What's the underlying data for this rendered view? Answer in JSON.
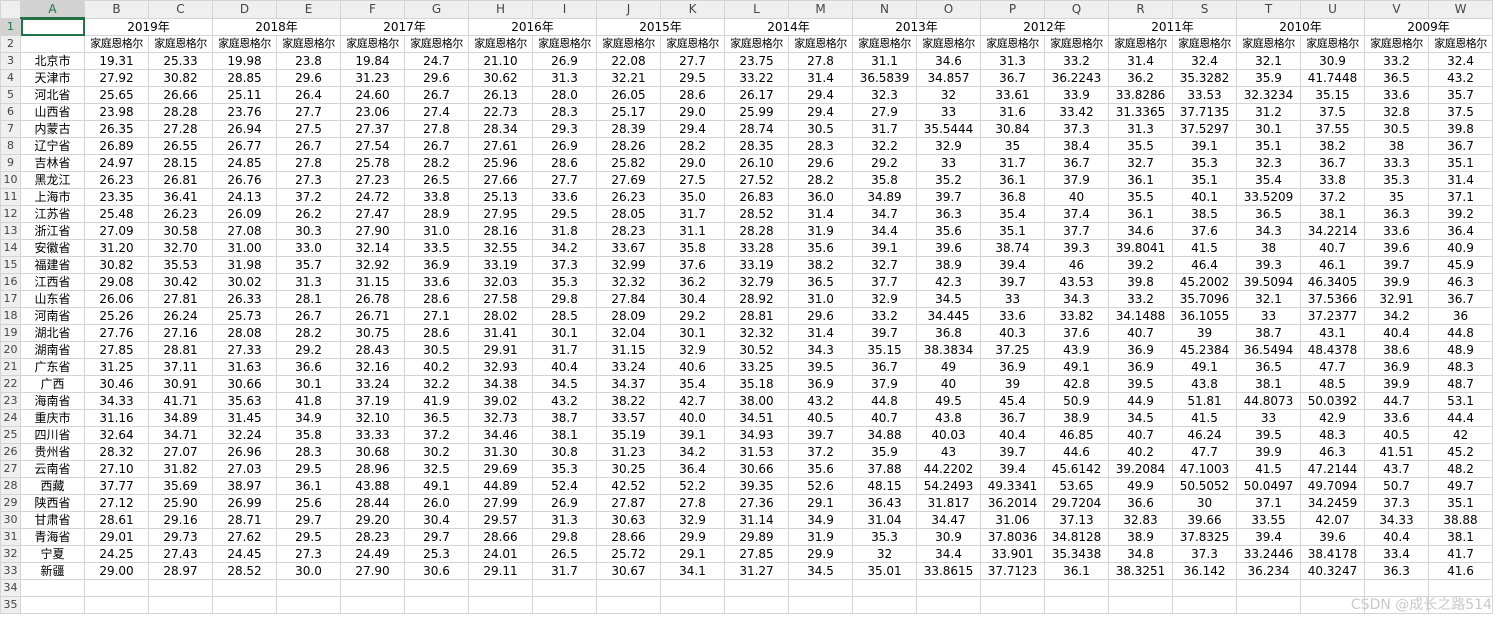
{
  "columns": [
    "A",
    "B",
    "C",
    "D",
    "E",
    "F",
    "G",
    "H",
    "I",
    "J",
    "K",
    "L",
    "M",
    "N",
    "O",
    "P",
    "Q",
    "R",
    "S",
    "T",
    "U",
    "V",
    "W"
  ],
  "years": [
    "2019年",
    "2018年",
    "2017年",
    "2016年",
    "2015年",
    "2014年",
    "2013年",
    "2012年",
    "2011年",
    "2010年",
    "2009年"
  ],
  "subheader": "家庭恩格尔",
  "rows": [
    {
      "label": "北京市",
      "values": [
        "19.31",
        "25.33",
        "19.98",
        "23.8",
        "19.84",
        "24.7",
        "21.10",
        "26.9",
        "22.08",
        "27.7",
        "23.75",
        "27.8",
        "31.1",
        "34.6",
        "31.3",
        "33.2",
        "31.4",
        "32.4",
        "32.1",
        "30.9",
        "33.2",
        "32.4"
      ]
    },
    {
      "label": "天津市",
      "values": [
        "27.92",
        "30.82",
        "28.85",
        "29.6",
        "31.23",
        "29.6",
        "30.62",
        "31.3",
        "32.21",
        "29.5",
        "33.22",
        "31.4",
        "36.5839",
        "34.857",
        "36.7",
        "36.2243",
        "36.2",
        "35.3282",
        "35.9",
        "41.7448",
        "36.5",
        "43.2"
      ]
    },
    {
      "label": "河北省",
      "values": [
        "25.65",
        "26.66",
        "25.11",
        "26.4",
        "24.60",
        "26.7",
        "26.13",
        "28.0",
        "26.05",
        "28.6",
        "26.17",
        "29.4",
        "32.3",
        "32",
        "33.61",
        "33.9",
        "33.8286",
        "33.53",
        "32.3234",
        "35.15",
        "33.6",
        "35.7"
      ]
    },
    {
      "label": "山西省",
      "values": [
        "23.98",
        "28.28",
        "23.76",
        "27.7",
        "23.06",
        "27.4",
        "22.73",
        "28.3",
        "25.17",
        "29.0",
        "25.99",
        "29.4",
        "27.9",
        "33",
        "31.6",
        "33.42",
        "31.3365",
        "37.7135",
        "31.2",
        "37.5",
        "32.8",
        "37.5"
      ]
    },
    {
      "label": "内蒙古",
      "values": [
        "26.35",
        "27.28",
        "26.94",
        "27.5",
        "27.37",
        "27.8",
        "28.34",
        "29.3",
        "28.39",
        "29.4",
        "28.74",
        "30.5",
        "31.7",
        "35.5444",
        "30.84",
        "37.3",
        "31.3",
        "37.5297",
        "30.1",
        "37.55",
        "30.5",
        "39.8"
      ]
    },
    {
      "label": "辽宁省",
      "values": [
        "26.89",
        "26.55",
        "26.77",
        "26.7",
        "27.54",
        "26.7",
        "27.61",
        "26.9",
        "28.26",
        "28.2",
        "28.35",
        "28.3",
        "32.2",
        "32.9",
        "35",
        "38.4",
        "35.5",
        "39.1",
        "35.1",
        "38.2",
        "38",
        "36.7"
      ]
    },
    {
      "label": "吉林省",
      "values": [
        "24.97",
        "28.15",
        "24.85",
        "27.8",
        "25.78",
        "28.2",
        "25.96",
        "28.6",
        "25.82",
        "29.0",
        "26.10",
        "29.6",
        "29.2",
        "33",
        "31.7",
        "36.7",
        "32.7",
        "35.3",
        "32.3",
        "36.7",
        "33.3",
        "35.1"
      ]
    },
    {
      "label": "黑龙江",
      "values": [
        "26.23",
        "26.81",
        "26.76",
        "27.3",
        "27.23",
        "26.5",
        "27.66",
        "27.7",
        "27.69",
        "27.5",
        "27.52",
        "28.2",
        "35.8",
        "35.2",
        "36.1",
        "37.9",
        "36.1",
        "35.1",
        "35.4",
        "33.8",
        "35.3",
        "31.4"
      ]
    },
    {
      "label": "上海市",
      "values": [
        "23.35",
        "36.41",
        "24.13",
        "37.2",
        "24.72",
        "33.8",
        "25.13",
        "33.6",
        "26.23",
        "35.0",
        "26.83",
        "36.0",
        "34.89",
        "39.7",
        "36.8",
        "40",
        "35.5",
        "40.1",
        "33.5209",
        "37.2",
        "35",
        "37.1"
      ]
    },
    {
      "label": "江苏省",
      "values": [
        "25.48",
        "26.23",
        "26.09",
        "26.2",
        "27.47",
        "28.9",
        "27.95",
        "29.5",
        "28.05",
        "31.7",
        "28.52",
        "31.4",
        "34.7",
        "36.3",
        "35.4",
        "37.4",
        "36.1",
        "38.5",
        "36.5",
        "38.1",
        "36.3",
        "39.2"
      ]
    },
    {
      "label": "浙江省",
      "values": [
        "27.09",
        "30.58",
        "27.08",
        "30.3",
        "27.90",
        "31.0",
        "28.16",
        "31.8",
        "28.23",
        "31.1",
        "28.28",
        "31.9",
        "34.4",
        "35.6",
        "35.1",
        "37.7",
        "34.6",
        "37.6",
        "34.3",
        "34.2214",
        "33.6",
        "36.4"
      ]
    },
    {
      "label": "安徽省",
      "values": [
        "31.20",
        "32.70",
        "31.00",
        "33.0",
        "32.14",
        "33.5",
        "32.55",
        "34.2",
        "33.67",
        "35.8",
        "33.28",
        "35.6",
        "39.1",
        "39.6",
        "38.74",
        "39.3",
        "39.8041",
        "41.5",
        "38",
        "40.7",
        "39.6",
        "40.9"
      ]
    },
    {
      "label": "福建省",
      "values": [
        "30.82",
        "35.53",
        "31.98",
        "35.7",
        "32.92",
        "36.9",
        "33.19",
        "37.3",
        "32.99",
        "37.6",
        "33.19",
        "38.2",
        "32.7",
        "38.9",
        "39.4",
        "46",
        "39.2",
        "46.4",
        "39.3",
        "46.1",
        "39.7",
        "45.9"
      ]
    },
    {
      "label": "江西省",
      "values": [
        "29.08",
        "30.42",
        "30.02",
        "31.3",
        "31.15",
        "33.6",
        "32.03",
        "35.3",
        "32.32",
        "36.2",
        "32.79",
        "36.5",
        "37.7",
        "42.3",
        "39.7",
        "43.53",
        "39.8",
        "45.2002",
        "39.5094",
        "46.3405",
        "39.9",
        "46.3"
      ]
    },
    {
      "label": "山东省",
      "values": [
        "26.06",
        "27.81",
        "26.33",
        "28.1",
        "26.78",
        "28.6",
        "27.58",
        "29.8",
        "27.84",
        "30.4",
        "28.92",
        "31.0",
        "32.9",
        "34.5",
        "33",
        "34.3",
        "33.2",
        "35.7096",
        "32.1",
        "37.5366",
        "32.91",
        "36.7"
      ]
    },
    {
      "label": "河南省",
      "values": [
        "25.26",
        "26.24",
        "25.73",
        "26.7",
        "26.71",
        "27.1",
        "28.02",
        "28.5",
        "28.09",
        "29.2",
        "28.81",
        "29.6",
        "33.2",
        "34.445",
        "33.6",
        "33.82",
        "34.1488",
        "36.1055",
        "33",
        "37.2377",
        "34.2",
        "36"
      ]
    },
    {
      "label": "湖北省",
      "values": [
        "27.76",
        "27.16",
        "28.08",
        "28.2",
        "30.75",
        "28.6",
        "31.41",
        "30.1",
        "32.04",
        "30.1",
        "32.32",
        "31.4",
        "39.7",
        "36.8",
        "40.3",
        "37.6",
        "40.7",
        "39",
        "38.7",
        "43.1",
        "40.4",
        "44.8"
      ]
    },
    {
      "label": "湖南省",
      "values": [
        "27.85",
        "28.81",
        "27.33",
        "29.2",
        "28.43",
        "30.5",
        "29.91",
        "31.7",
        "31.15",
        "32.9",
        "30.52",
        "34.3",
        "35.15",
        "38.3834",
        "37.25",
        "43.9",
        "36.9",
        "45.2384",
        "36.5494",
        "48.4378",
        "38.6",
        "48.9"
      ]
    },
    {
      "label": "广东省",
      "values": [
        "31.25",
        "37.11",
        "31.63",
        "36.6",
        "32.16",
        "40.2",
        "32.93",
        "40.4",
        "33.24",
        "40.6",
        "33.25",
        "39.5",
        "36.7",
        "49",
        "36.9",
        "49.1",
        "36.9",
        "49.1",
        "36.5",
        "47.7",
        "36.9",
        "48.3"
      ]
    },
    {
      "label": "广西",
      "values": [
        "30.46",
        "30.91",
        "30.66",
        "30.1",
        "33.24",
        "32.2",
        "34.38",
        "34.5",
        "34.37",
        "35.4",
        "35.18",
        "36.9",
        "37.9",
        "40",
        "39",
        "42.8",
        "39.5",
        "43.8",
        "38.1",
        "48.5",
        "39.9",
        "48.7"
      ]
    },
    {
      "label": "海南省",
      "values": [
        "34.33",
        "41.71",
        "35.63",
        "41.8",
        "37.19",
        "41.9",
        "39.02",
        "43.2",
        "38.22",
        "42.7",
        "38.00",
        "43.2",
        "44.8",
        "49.5",
        "45.4",
        "50.9",
        "44.9",
        "51.81",
        "44.8073",
        "50.0392",
        "44.7",
        "53.1"
      ]
    },
    {
      "label": "重庆市",
      "values": [
        "31.16",
        "34.89",
        "31.45",
        "34.9",
        "32.10",
        "36.5",
        "32.73",
        "38.7",
        "33.57",
        "40.0",
        "34.51",
        "40.5",
        "40.7",
        "43.8",
        "36.7",
        "38.9",
        "34.5",
        "41.5",
        "33",
        "42.9",
        "33.6",
        "44.4"
      ]
    },
    {
      "label": "四川省",
      "values": [
        "32.64",
        "34.71",
        "32.24",
        "35.8",
        "33.33",
        "37.2",
        "34.46",
        "38.1",
        "35.19",
        "39.1",
        "34.93",
        "39.7",
        "34.88",
        "40.03",
        "40.4",
        "46.85",
        "40.7",
        "46.24",
        "39.5",
        "48.3",
        "40.5",
        "42"
      ]
    },
    {
      "label": "贵州省",
      "values": [
        "28.32",
        "27.07",
        "26.96",
        "28.3",
        "30.68",
        "30.2",
        "31.30",
        "30.8",
        "31.23",
        "34.2",
        "31.53",
        "37.2",
        "35.9",
        "43",
        "39.7",
        "44.6",
        "40.2",
        "47.7",
        "39.9",
        "46.3",
        "41.51",
        "45.2"
      ]
    },
    {
      "label": "云南省",
      "values": [
        "27.10",
        "31.82",
        "27.03",
        "29.5",
        "28.96",
        "32.5",
        "29.69",
        "35.3",
        "30.25",
        "36.4",
        "30.66",
        "35.6",
        "37.88",
        "44.2202",
        "39.4",
        "45.6142",
        "39.2084",
        "47.1003",
        "41.5",
        "47.2144",
        "43.7",
        "48.2"
      ]
    },
    {
      "label": "西藏",
      "values": [
        "37.77",
        "35.69",
        "38.97",
        "36.1",
        "43.88",
        "49.1",
        "44.89",
        "52.4",
        "42.52",
        "52.2",
        "39.35",
        "52.6",
        "48.15",
        "54.2493",
        "49.3341",
        "53.65",
        "49.9",
        "50.5052",
        "50.0497",
        "49.7094",
        "50.7",
        "49.7"
      ]
    },
    {
      "label": "陕西省",
      "values": [
        "27.12",
        "25.90",
        "26.99",
        "25.6",
        "28.44",
        "26.0",
        "27.99",
        "26.9",
        "27.87",
        "27.8",
        "27.36",
        "29.1",
        "36.43",
        "31.817",
        "36.2014",
        "29.7204",
        "36.6",
        "30",
        "37.1",
        "34.2459",
        "37.3",
        "35.1"
      ]
    },
    {
      "label": "甘肃省",
      "values": [
        "28.61",
        "29.16",
        "28.71",
        "29.7",
        "29.20",
        "30.4",
        "29.57",
        "31.3",
        "30.63",
        "32.9",
        "31.14",
        "34.9",
        "31.04",
        "34.47",
        "31.06",
        "37.13",
        "32.83",
        "39.66",
        "33.55",
        "42.07",
        "34.33",
        "38.88"
      ]
    },
    {
      "label": "青海省",
      "values": [
        "29.01",
        "29.73",
        "27.62",
        "29.5",
        "28.23",
        "29.7",
        "28.66",
        "29.8",
        "28.66",
        "29.9",
        "29.89",
        "31.9",
        "35.3",
        "30.9",
        "37.8036",
        "34.8128",
        "38.9",
        "37.8325",
        "39.4",
        "39.6",
        "40.4",
        "38.1"
      ]
    },
    {
      "label": "宁夏",
      "values": [
        "24.25",
        "27.43",
        "24.45",
        "27.3",
        "24.49",
        "25.3",
        "24.01",
        "26.5",
        "25.72",
        "29.1",
        "27.85",
        "29.9",
        "32",
        "34.4",
        "33.901",
        "35.3438",
        "34.8",
        "37.3",
        "33.2446",
        "38.4178",
        "33.4",
        "41.7"
      ]
    },
    {
      "label": "新疆",
      "values": [
        "29.00",
        "28.97",
        "28.52",
        "30.0",
        "27.90",
        "30.6",
        "29.11",
        "31.7",
        "30.67",
        "34.1",
        "31.27",
        "34.5",
        "35.01",
        "33.8615",
        "37.7123",
        "36.1",
        "38.3251",
        "36.142",
        "36.234",
        "40.3247",
        "36.3",
        "41.6"
      ]
    },
    {
      "label": "",
      "values": []
    },
    {
      "label": "",
      "values": []
    }
  ],
  "row_numbers": [
    "1",
    "2",
    "3",
    "4",
    "5",
    "6",
    "7",
    "8",
    "9",
    "10",
    "11",
    "12",
    "13",
    "14",
    "15",
    "16",
    "17",
    "18",
    "19",
    "20",
    "21",
    "22",
    "23",
    "24",
    "25",
    "26",
    "27",
    "28",
    "29",
    "30",
    "31",
    "32",
    "33",
    "34",
    "35"
  ],
  "selected_cell": "A1",
  "watermark": "CSDN @成长之路514"
}
